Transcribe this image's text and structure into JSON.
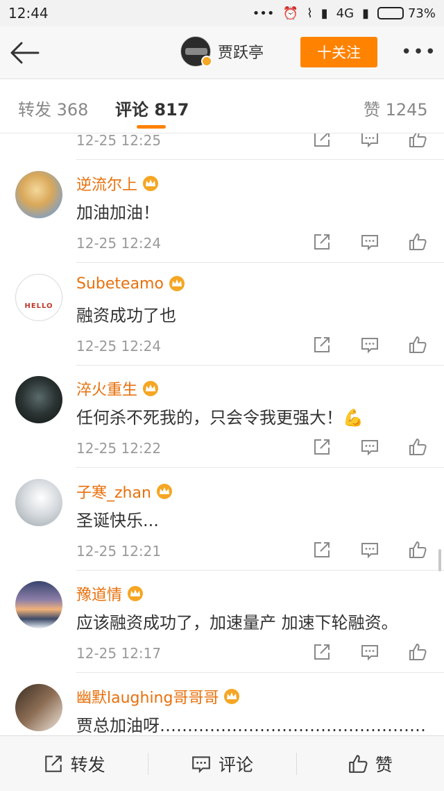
{
  "status": {
    "time": "12:44",
    "dots": "•••",
    "network": "4G",
    "battery": "73%",
    "battery_level": 0.73
  },
  "nav": {
    "name": "贾跃亭",
    "follow": "十关注",
    "more": "•••"
  },
  "tabs": [
    {
      "label": "转发 368"
    },
    {
      "label": "评论 817"
    },
    {
      "label": "赞 1245"
    }
  ],
  "partial_time": "12-25 12:25",
  "comments": [
    {
      "name": "逆流尔上",
      "text": "加油加油！",
      "time": "12-25 12:24"
    },
    {
      "name": "Subeteamo",
      "text": "融资成功了也",
      "time": "12-25 12:24",
      "avatar_text": "HELLO"
    },
    {
      "name": "淬火重生",
      "text": "任何杀不死我的，只会令我更强大！💪",
      "time": "12-25 12:22"
    },
    {
      "name": "子寒_zhan",
      "text": "圣诞快乐...",
      "time": "12-25 12:21"
    },
    {
      "name": "豫道情",
      "text": "应该融资成功了，加速量产 加速下轮融资。",
      "time": "12-25 12:17"
    },
    {
      "name": "幽默laughing哥哥哥",
      "text": "贾总加油呀…………………………………………",
      "time": ""
    }
  ],
  "bottom": {
    "repost": "转发",
    "comment": "评论",
    "like": "赞"
  },
  "colors": {
    "accent": "#ff8200",
    "username": "#e8700c",
    "crown": "#f5a623"
  }
}
